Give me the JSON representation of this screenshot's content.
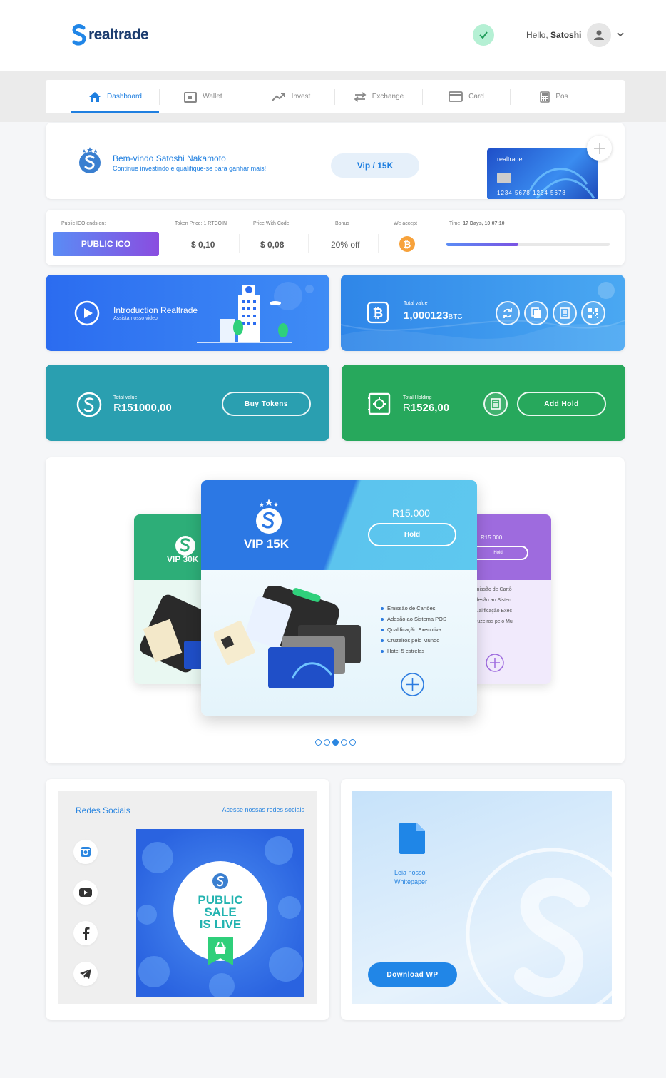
{
  "header": {
    "logo_text": "realtrade",
    "greeting": "Hello,",
    "user_name": "Satoshi"
  },
  "nav": [
    {
      "label": "Dashboard",
      "icon": "home-icon",
      "active": true
    },
    {
      "label": "Wallet",
      "icon": "wallet-icon"
    },
    {
      "label": "Invest",
      "icon": "trend-icon"
    },
    {
      "label": "Exchange",
      "icon": "exchange-icon"
    },
    {
      "label": "Card",
      "icon": "card-icon"
    },
    {
      "label": "Pos",
      "icon": "calculator-icon"
    }
  ],
  "welcome": {
    "title": "Bem-vindo Satoshi Nakamoto",
    "subtitle": "Continue investindo e qualifique-se para ganhar mais!",
    "vip_label": "Vip / 15K",
    "card_brand": "realtrade",
    "card_number": "1234 5678 1234 5678"
  },
  "ico": {
    "ends_label": "Public ICO ends on:",
    "button_label": "PUBLIC ICO",
    "token_price_label": "Token Price: 1 RTCOIN",
    "token_price": "$ 0,10",
    "price_code_label": "Price With Code",
    "price_code": "$ 0,08",
    "bonus_label": "Bonus",
    "bonus": "20% off",
    "accept_label": "We accept",
    "time_label": "Time",
    "time_value": "17 Days, 10:07:10",
    "progress": 0.44
  },
  "intro": {
    "title": "Introduction Realtrade",
    "subtitle": "Assista nosso video"
  },
  "btc_total": {
    "label": "Total value",
    "value": "1,000123",
    "unit": "BTC"
  },
  "tokens": {
    "label": "Total value",
    "currency": "R",
    "value": "151000,00",
    "button": "Buy Tokens"
  },
  "holding": {
    "label": "Total Holding",
    "currency": "R",
    "value": "1526,00",
    "button": "Add Hold"
  },
  "vip_card": {
    "title": "VIP 15K",
    "price": "R15.000",
    "hold_label": "Hold",
    "features": [
      "Emissão de Cartões",
      "Adesão ao Sistema POS",
      "Qualificação Executiva",
      "Cruzeiros pelo Mundo",
      "Hotel 5 estrelas"
    ],
    "left_title": "VIP 30K",
    "right_price": "R15.000",
    "right_hold": "Hold",
    "right_features": [
      "Emissão de Cartõ",
      "Adesão ao Sisten",
      "Qualificação Exec",
      "Cruzeiros pelo Mu"
    ],
    "active_slide": 2,
    "slides": 5
  },
  "social": {
    "title": "Redes Sociais",
    "link": "Acesse nossas redes sociais",
    "banner_text": [
      "PUBLIC",
      "SALE",
      "IS LIVE"
    ]
  },
  "whitepaper": {
    "line1": "Leia nosso",
    "line2": "Whitepaper",
    "button": "Download WP"
  },
  "colors": {
    "primary": "#1f7fe0",
    "teal": "#2a9fb0",
    "green": "#27a85c",
    "purple": "#8a4de0",
    "bitcoin": "#f7a23b"
  }
}
